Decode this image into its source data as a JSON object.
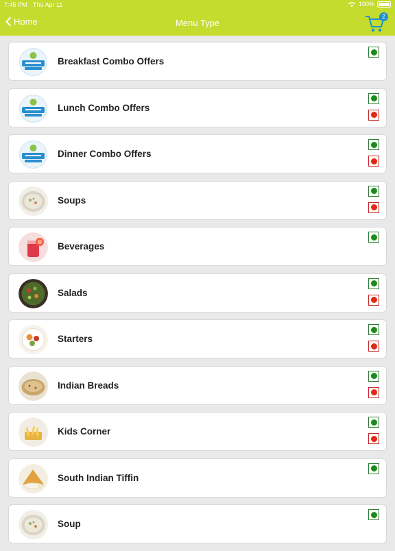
{
  "status_bar": {
    "time": "7:45 PM",
    "date": "Thu Apr 11",
    "battery": "100%"
  },
  "nav": {
    "back_label": "Home",
    "title": "Menu Type",
    "cart_count": "2"
  },
  "colors": {
    "accent": "#c3dc2d",
    "veg": "#1b8a1b",
    "non_veg": "#e02a16",
    "badge": "#1f8fd0"
  },
  "items": [
    {
      "label": "Breakfast Combo Offers",
      "icon": "logo",
      "veg": true,
      "non_veg": false
    },
    {
      "label": "Lunch Combo Offers",
      "icon": "logo",
      "veg": true,
      "non_veg": true
    },
    {
      "label": "Dinner Combo Offers",
      "icon": "logo",
      "veg": true,
      "non_veg": true
    },
    {
      "label": "Soups",
      "icon": "soup",
      "veg": true,
      "non_veg": true
    },
    {
      "label": "Beverages",
      "icon": "beverage",
      "veg": true,
      "non_veg": false
    },
    {
      "label": "Salads",
      "icon": "salad",
      "veg": true,
      "non_veg": true
    },
    {
      "label": "Starters",
      "icon": "starter",
      "veg": true,
      "non_veg": true
    },
    {
      "label": "Indian Breads",
      "icon": "bread",
      "veg": true,
      "non_veg": true
    },
    {
      "label": "Kids Corner",
      "icon": "kids",
      "veg": true,
      "non_veg": true
    },
    {
      "label": "South Indian Tiffin",
      "icon": "tiffin",
      "veg": true,
      "non_veg": false
    },
    {
      "label": "Soup",
      "icon": "soup",
      "veg": true,
      "non_veg": false
    }
  ]
}
